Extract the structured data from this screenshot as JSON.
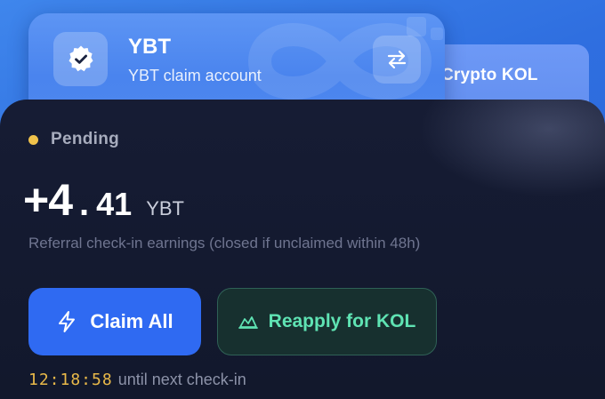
{
  "back_card": {
    "label": "Crypto KOL"
  },
  "account_card": {
    "title": "YBT",
    "subtitle": "YBT claim account",
    "logo_icon": "check-badge-icon",
    "switch_icon": "swap-arrows-icon"
  },
  "earnings": {
    "status": "Pending",
    "status_color": "#f0c24b",
    "amount_int": "+4",
    "amount_sep": ".",
    "amount_dec": "41",
    "unit": "YBT",
    "description": "Referral check-in earnings (closed if unclaimed within 48h)"
  },
  "actions": {
    "claim_label": "Claim All",
    "claim_icon": "lightning-icon",
    "claim_color": "#2f6af2",
    "reapply_label": "Reapply for KOL",
    "reapply_icon": "chart-peak-icon",
    "reapply_color": "#5fe3b3"
  },
  "countdown": {
    "time": "12:18:58",
    "text": "until next check-in"
  }
}
